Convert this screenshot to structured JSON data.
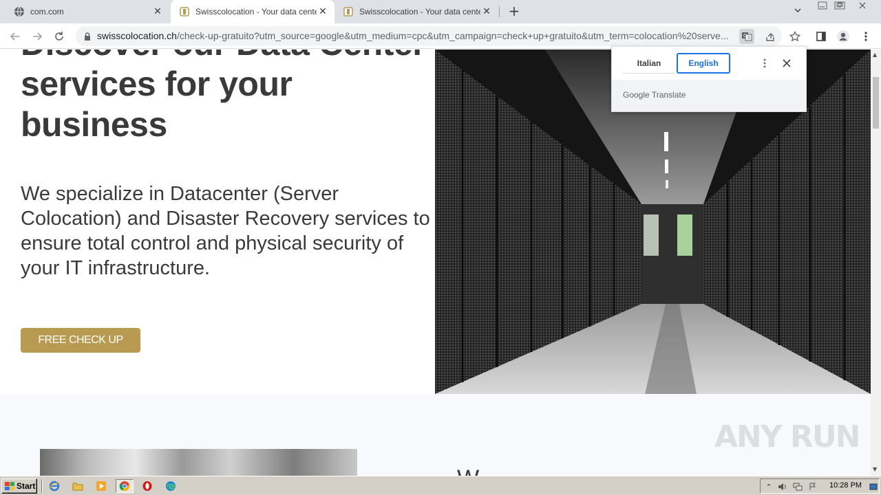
{
  "browser": {
    "tabs": [
      {
        "title": "com.com",
        "icon": "globe-icon",
        "active": false
      },
      {
        "title": "Swisscolocation - Your data center",
        "icon": "swisscolocation-favicon",
        "active": true
      },
      {
        "title": "Swisscolocation - Your data center",
        "icon": "swisscolocation-favicon",
        "active": false
      }
    ],
    "url_host": "swisscolocation.ch",
    "url_rest": "/check-up-gratuito?utm_source=google&utm_medium=cpc&utm_campaign=check+up+gratuito&utm_term=colocation%20serve..."
  },
  "translate_popup": {
    "source_lang": "Italian",
    "target_lang": "English",
    "selected": "English",
    "brand_google": "Google",
    "brand_translate": "Translate"
  },
  "hero": {
    "headline": "Discover our Data Center services for your business",
    "subtext": "We specialize in Datacenter (Server Colocation) and Disaster Recovery services to ensure total control and physical security of your IT infrastructure.",
    "cta_label": "FREE CHECK UP",
    "image_alt": "Data center server corridor"
  },
  "section2": {
    "heading_partial": "W"
  },
  "watermark": "ANY RUN",
  "taskbar": {
    "start_label": "Start",
    "clock": "10:28 PM",
    "apps": [
      "ie-icon",
      "folder-icon",
      "media-player-icon",
      "chrome-icon",
      "opera-icon",
      "edge-icon"
    ]
  },
  "colors": {
    "cta": "#b89a50",
    "text": "#3a3a3a",
    "accent_blue": "#1a73e8"
  }
}
